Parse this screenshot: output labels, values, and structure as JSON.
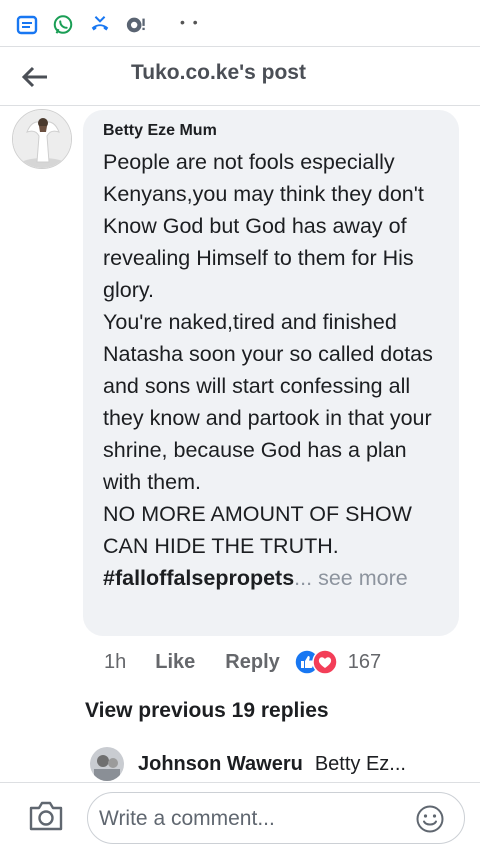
{
  "status_bar": {
    "icons": [
      "message-app-icon",
      "whatsapp-icon",
      "missed-call-icon",
      "notification-app-icon"
    ],
    "dots": "• •"
  },
  "header": {
    "title": "Tuko.co.ke's post",
    "back_icon": "arrow-left-icon"
  },
  "comment": {
    "author": "Betty Eze Mum",
    "text": "People are not fools especially Kenyans,you may think they don't Know God but God has away of revealing Himself to them for His glory.\nYou're naked,tired and finished Natasha soon your so called dotas and sons will start confessing all they know and partook in that your shrine, because God has a plan with them.\nNO MORE AMOUNT OF SHOW CAN HIDE THE TRUTH.",
    "hashtag": "#falloffalsepropets",
    "ellipsis": "...",
    "see_more": " see more",
    "time": "1h",
    "like_label": "Like",
    "reply_label": "Reply",
    "reaction_icons": [
      "like-reaction-icon",
      "love-reaction-icon"
    ],
    "reaction_count": "167"
  },
  "replies": {
    "view_previous": "View previous 19 replies",
    "items": [
      {
        "author": "Johnson Waweru",
        "snippet": "Betty Ez..."
      }
    ]
  },
  "composer": {
    "placeholder": "Write a comment...",
    "camera_icon": "camera-icon",
    "emoji_icon": "emoji-icon"
  },
  "colors": {
    "bubble_bg": "#f0f2f5",
    "like_blue": "#1877f2",
    "love_red": "#f33e58",
    "muted_text": "#65676b"
  }
}
